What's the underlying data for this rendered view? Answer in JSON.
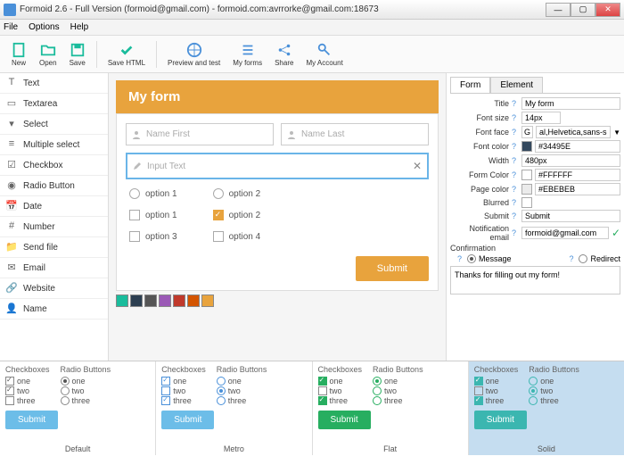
{
  "window": {
    "title": "Formoid 2.6 - Full Version (formoid@gmail.com) - formoid.com:avrrorke@gmail.com:18673"
  },
  "menu": {
    "file": "File",
    "options": "Options",
    "help": "Help"
  },
  "toolbar": {
    "new": "New",
    "open": "Open",
    "save": "Save",
    "savehtml": "Save HTML",
    "preview": "Preview and test",
    "myforms": "My forms",
    "share": "Share",
    "account": "My Account"
  },
  "sidebar": [
    "Text",
    "Textarea",
    "Select",
    "Multiple select",
    "Checkbox",
    "Radio Button",
    "Date",
    "Number",
    "Send file",
    "Email",
    "Website",
    "Name"
  ],
  "form": {
    "title": "My form",
    "name_first": "Name First",
    "name_last": "Name Last",
    "input_text": "Input Text",
    "radio": [
      "option 1",
      "option 2"
    ],
    "checks": [
      "option 1",
      "option 2",
      "option 3",
      "option 4"
    ],
    "submit": "Submit"
  },
  "palette": [
    "#1abc9c",
    "#2c3e50",
    "#555555",
    "#9b59b6",
    "#c0392b",
    "#d35400",
    "#e8a33d"
  ],
  "props": {
    "tab_form": "Form",
    "tab_element": "Element",
    "title_l": "Title",
    "title_v": "My form",
    "fontsize_l": "Font size",
    "fontsize_v": "14px",
    "fontface_l": "Font face",
    "fontface_v": "al,Helvetica,sans-serif",
    "fontcolor_l": "Font color",
    "fontcolor_v": "#34495E",
    "width_l": "Width",
    "width_v": "480px",
    "formcolor_l": "Form Color",
    "formcolor_v": "#FFFFFF",
    "pagecolor_l": "Page color",
    "pagecolor_v": "#EBEBEB",
    "blurred_l": "Blurred",
    "submit_l": "Submit",
    "submit_v": "Submit",
    "email_l": "Notification email",
    "email_v": "formoid@gmail.com",
    "confirm_l": "Confirmation",
    "msg_l": "Message",
    "redirect_l": "Redirect",
    "confirm_text": "Thanks for filling out my form!"
  },
  "themes": {
    "checkboxes": "Checkboxes",
    "radios": "Radio Buttons",
    "opts": [
      "one",
      "two",
      "three"
    ],
    "submit": "Submit",
    "names": [
      "Default",
      "Metro",
      "Flat",
      "Solid"
    ],
    "colors": {
      "default": "#6cbde8",
      "metro": "#6cbde8",
      "flat": "#27ae60",
      "solid": "#3bb6b0"
    }
  }
}
